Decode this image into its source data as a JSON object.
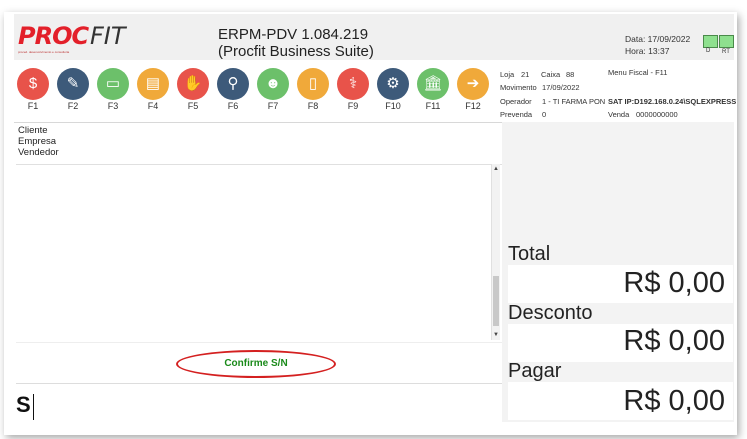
{
  "header": {
    "logo_proc": "PROC",
    "logo_fit": "FIT",
    "logo_tagline": "proced. desenvolvimento e consultoria",
    "title_line1": "ERPM-PDV 1.084.219",
    "title_line2": "(Procfit Business Suite)",
    "date_label": "Data: 17/09/2022",
    "time_label": "Hora: 13:37",
    "status_labels": [
      "D",
      "RT"
    ]
  },
  "fkeys": [
    {
      "label": "F1",
      "icon": "money-icon",
      "color": "#e8534a"
    },
    {
      "label": "F2",
      "icon": "pen-icon",
      "color": "#3d5a7a"
    },
    {
      "label": "F3",
      "icon": "card-icon",
      "color": "#6cc06a"
    },
    {
      "label": "F4",
      "icon": "id-card-icon",
      "color": "#f0a93a"
    },
    {
      "label": "F5",
      "icon": "hand-icon",
      "color": "#e8534a"
    },
    {
      "label": "F6",
      "icon": "search-icon",
      "color": "#3d5a7a"
    },
    {
      "label": "F7",
      "icon": "users-icon",
      "color": "#6cc06a"
    },
    {
      "label": "F8",
      "icon": "phone-icon",
      "color": "#f0a93a"
    },
    {
      "label": "F9",
      "icon": "medical-icon",
      "color": "#e8534a"
    },
    {
      "label": "F10",
      "icon": "gear-icon",
      "color": "#3d5a7a"
    },
    {
      "label": "F11",
      "icon": "bank-icon",
      "color": "#6cc06a"
    },
    {
      "label": "F12",
      "icon": "arrow-right-icon",
      "color": "#f0a93a"
    }
  ],
  "info": {
    "loja_label": "Loja",
    "loja_value": "21",
    "caixa_label": "Caixa",
    "caixa_value": "88",
    "menu_fiscal": "Menu Fiscal - F11",
    "movimento_label": "Movimento",
    "movimento_value": "17/09/2022",
    "operador_label": "Operador",
    "operador_value": "1 - TI FARMA PON",
    "sat_value": "SAT IP:D192.168.0.24\\SQLEXPRESS",
    "prevenda_label": "Prevenda",
    "prevenda_value": "0",
    "venda_label": "Venda",
    "venda_value": "0000000000"
  },
  "customer": {
    "cliente_label": "Cliente",
    "empresa_label": "Empresa",
    "vendedor_label": "Vendedor"
  },
  "prompt": {
    "confirm_text": "Confirme S/N",
    "input_value": "S"
  },
  "totals": {
    "total_label": "Total",
    "total_value": "R$ 0,00",
    "desconto_label": "Desconto",
    "desconto_value": "R$ 0,00",
    "pagar_label": "Pagar",
    "pagar_value": "R$ 0,00"
  }
}
